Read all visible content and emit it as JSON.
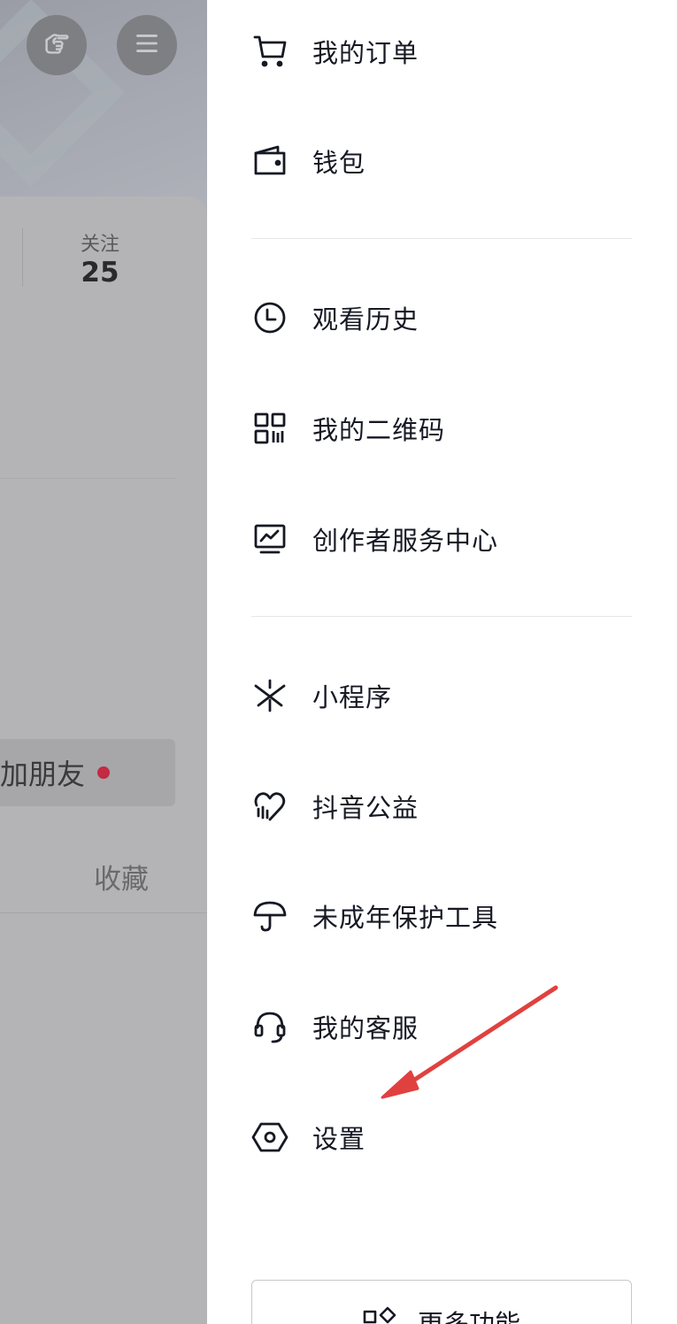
{
  "background": {
    "follow_label": "关注",
    "follow_count": "25",
    "add_friend_label": "加朋友",
    "favorites_tab": "收藏"
  },
  "drawer": {
    "items": [
      {
        "label": "我的订单",
        "icon": "cart-icon"
      },
      {
        "label": "钱包",
        "icon": "wallet-icon"
      },
      {
        "label": "观看历史",
        "icon": "clock-icon"
      },
      {
        "label": "我的二维码",
        "icon": "qr-code-icon"
      },
      {
        "label": "创作者服务中心",
        "icon": "monitor-chart-icon"
      },
      {
        "label": "小程序",
        "icon": "mini-program-icon"
      },
      {
        "label": "抖音公益",
        "icon": "charity-heart-icon"
      },
      {
        "label": "未成年保护工具",
        "icon": "umbrella-icon"
      },
      {
        "label": "我的客服",
        "icon": "headset-icon"
      },
      {
        "label": "设置",
        "icon": "hexagon-settings-icon"
      }
    ],
    "more_label": "更多功能"
  },
  "colors": {
    "overlay": "#b4b4b6",
    "text": "#161823",
    "red_dot": "#c42a43",
    "arrow": "#e0413f"
  }
}
